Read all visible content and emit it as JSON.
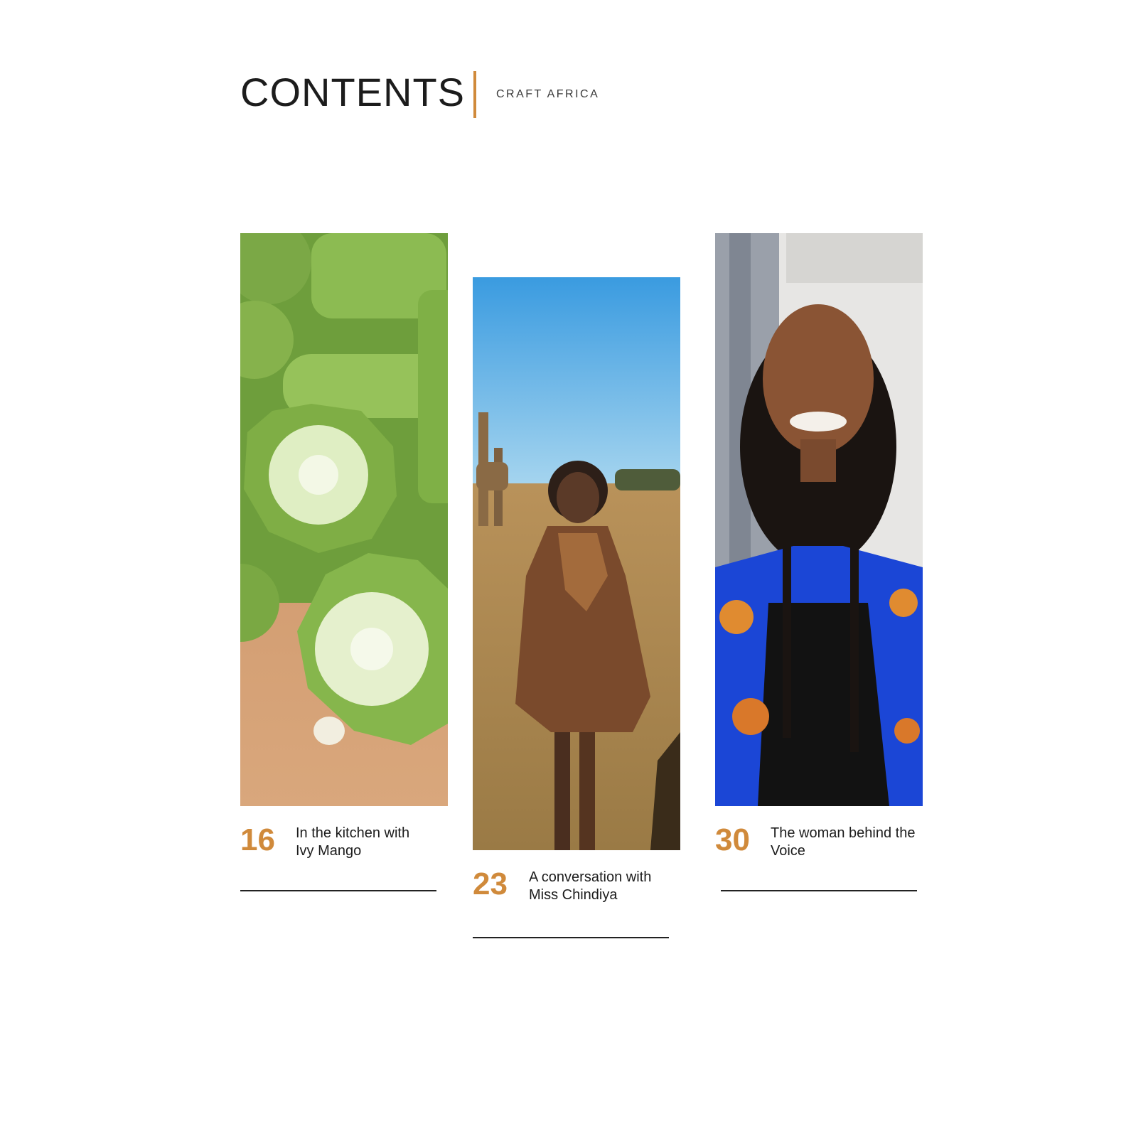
{
  "header": {
    "title": "CONTENTS",
    "subtitle": "CRAFT AFRICA",
    "accent_color": "#d08a3b"
  },
  "articles": [
    {
      "page": "16",
      "caption_line1": "In the kitchen with",
      "caption_line2": "Ivy Mango",
      "image": "okra-slices-photo"
    },
    {
      "page": "23",
      "caption_line1": "A conversation with",
      "caption_line2": "Miss Chindiya",
      "image": "woman-in-savanna-with-giraffes-photo"
    },
    {
      "page": "30",
      "caption_line1": "The woman behind the",
      "caption_line2": "Voice",
      "image": "smiling-woman-portrait-photo"
    }
  ]
}
